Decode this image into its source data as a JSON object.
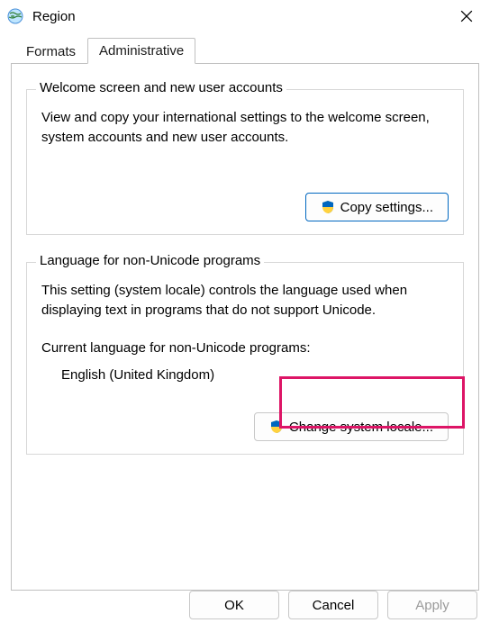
{
  "window": {
    "title": "Region"
  },
  "tabs": {
    "formats": "Formats",
    "administrative": "Administrative"
  },
  "group_welcome": {
    "legend": "Welcome screen and new user accounts",
    "desc": "View and copy your international settings to the welcome screen, system accounts and new user accounts.",
    "copy_btn": "Copy settings..."
  },
  "group_locale": {
    "legend": "Language for non-Unicode programs",
    "desc": "This setting (system locale) controls the language used when displaying text in programs that do not support Unicode.",
    "current_label": "Current language for non-Unicode programs:",
    "current_value": "English (United Kingdom)",
    "change_btn": "Change system locale..."
  },
  "buttons": {
    "ok": "OK",
    "cancel": "Cancel",
    "apply": "Apply"
  }
}
